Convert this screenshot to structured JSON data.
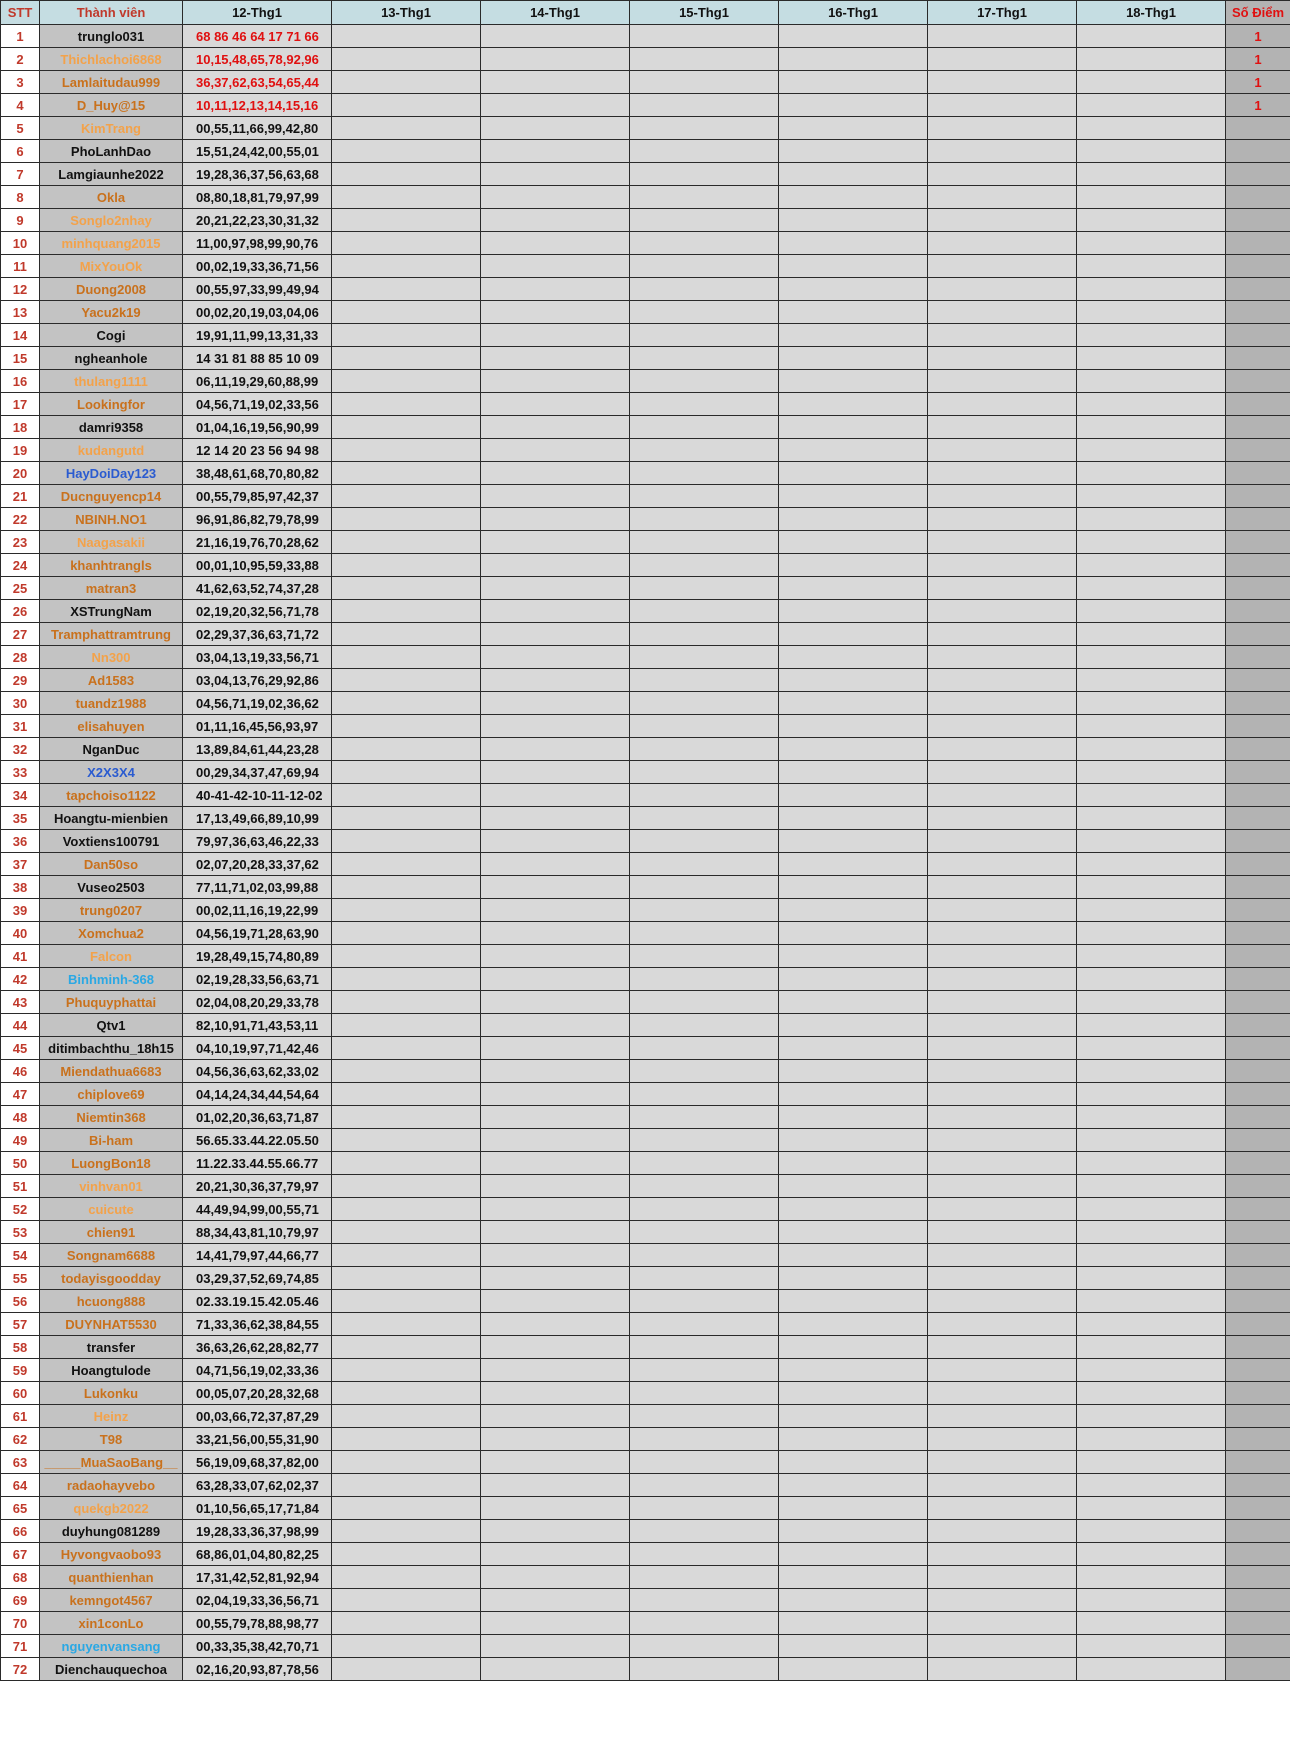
{
  "headers": {
    "stt": "STT",
    "member": "Thành viên",
    "days": [
      "12-Thg1",
      "13-Thg1",
      "14-Thg1",
      "15-Thg1",
      "16-Thg1",
      "17-Thg1",
      "18-Thg1"
    ],
    "points": "Số Điểm"
  },
  "colors": {
    "black": "#111111",
    "orange": "#c9711c",
    "light": "#f3a24a",
    "blue": "#2a5bd0",
    "cyan": "#2aa8e4",
    "red": "#e01010",
    "header_bg": "#c5dde2"
  },
  "rows": [
    {
      "stt": "1",
      "name": "trunglo031",
      "color": "black",
      "d12": "68 86 46 64 17 71 66",
      "red": true,
      "points": "1"
    },
    {
      "stt": "2",
      "name": "Thichlachoi6868",
      "color": "light",
      "d12": "10,15,48,65,78,92,96",
      "red": true,
      "points": "1"
    },
    {
      "stt": "3",
      "name": "Lamlaitudau999",
      "color": "orange",
      "d12": "36,37,62,63,54,65,44",
      "red": true,
      "points": "1"
    },
    {
      "stt": "4",
      "name": "D_Huy@15",
      "color": "orange",
      "d12": "10,11,12,13,14,15,16",
      "red": true,
      "points": "1"
    },
    {
      "stt": "5",
      "name": "KimTrang",
      "color": "light",
      "d12": "00,55,11,66,99,42,80",
      "red": false,
      "points": ""
    },
    {
      "stt": "6",
      "name": "PhoLanhDao",
      "color": "black",
      "d12": "15,51,24,42,00,55,01",
      "red": false,
      "points": ""
    },
    {
      "stt": "7",
      "name": "Lamgiaunhe2022",
      "color": "black",
      "d12": "19,28,36,37,56,63,68",
      "red": false,
      "points": ""
    },
    {
      "stt": "8",
      "name": "Okla",
      "color": "orange",
      "d12": "08,80,18,81,79,97,99",
      "red": false,
      "points": ""
    },
    {
      "stt": "9",
      "name": "Songlo2nhay",
      "color": "light",
      "d12": "20,21,22,23,30,31,32",
      "red": false,
      "points": ""
    },
    {
      "stt": "10",
      "name": "minhquang2015",
      "color": "light",
      "d12": "11,00,97,98,99,90,76",
      "red": false,
      "points": ""
    },
    {
      "stt": "11",
      "name": "MixYouOk",
      "color": "light",
      "d12": "00,02,19,33,36,71,56",
      "red": false,
      "points": ""
    },
    {
      "stt": "12",
      "name": "Duong2008",
      "color": "orange",
      "d12": "00,55,97,33,99,49,94",
      "red": false,
      "points": ""
    },
    {
      "stt": "13",
      "name": "Yacu2k19",
      "color": "orange",
      "d12": "00,02,20,19,03,04,06",
      "red": false,
      "points": ""
    },
    {
      "stt": "14",
      "name": "Cogi",
      "color": "black",
      "d12": "19,91,11,99,13,31,33",
      "red": false,
      "points": ""
    },
    {
      "stt": "15",
      "name": "ngheanhole",
      "color": "black",
      "d12": "14 31 81 88 85 10 09",
      "red": false,
      "points": ""
    },
    {
      "stt": "16",
      "name": "thulang1111",
      "color": "light",
      "d12": "06,11,19,29,60,88,99",
      "red": false,
      "points": ""
    },
    {
      "stt": "17",
      "name": "Lookingfor",
      "color": "orange",
      "d12": "04,56,71,19,02,33,56",
      "red": false,
      "points": ""
    },
    {
      "stt": "18",
      "name": "damri9358",
      "color": "black",
      "d12": "01,04,16,19,56,90,99",
      "red": false,
      "points": ""
    },
    {
      "stt": "19",
      "name": "kudangutd",
      "color": "light",
      "d12": "12 14 20 23 56 94 98",
      "red": false,
      "points": ""
    },
    {
      "stt": "20",
      "name": "HayDoiDay123",
      "color": "blue",
      "d12": "38,48,61,68,70,80,82",
      "red": false,
      "points": ""
    },
    {
      "stt": "21",
      "name": "Ducnguyencp14",
      "color": "orange",
      "d12": "00,55,79,85,97,42,37",
      "red": false,
      "points": ""
    },
    {
      "stt": "22",
      "name": "NBINH.NO1",
      "color": "orange",
      "d12": "96,91,86,82,79,78,99",
      "red": false,
      "points": ""
    },
    {
      "stt": "23",
      "name": "Naagasakii",
      "color": "light",
      "d12": "21,16,19,76,70,28,62",
      "red": false,
      "points": ""
    },
    {
      "stt": "24",
      "name": "khanhtrangls",
      "color": "orange",
      "d12": "00,01,10,95,59,33,88",
      "red": false,
      "points": ""
    },
    {
      "stt": "25",
      "name": "matran3",
      "color": "orange",
      "d12": "41,62,63,52,74,37,28",
      "red": false,
      "points": ""
    },
    {
      "stt": "26",
      "name": "XSTrungNam",
      "color": "black",
      "d12": "02,19,20,32,56,71,78",
      "red": false,
      "points": ""
    },
    {
      "stt": "27",
      "name": "Tramphattramtrung",
      "color": "orange",
      "d12": "02,29,37,36,63,71,72",
      "red": false,
      "points": ""
    },
    {
      "stt": "28",
      "name": "Nn300",
      "color": "light",
      "d12": "03,04,13,19,33,56,71",
      "red": false,
      "points": ""
    },
    {
      "stt": "29",
      "name": "Ad1583",
      "color": "orange",
      "d12": "03,04,13,76,29,92,86",
      "red": false,
      "points": ""
    },
    {
      "stt": "30",
      "name": "tuandz1988",
      "color": "orange",
      "d12": "04,56,71,19,02,36,62",
      "red": false,
      "points": ""
    },
    {
      "stt": "31",
      "name": "elisahuyen",
      "color": "orange",
      "d12": "01,11,16,45,56,93,97",
      "red": false,
      "points": ""
    },
    {
      "stt": "32",
      "name": "NganDuc",
      "color": "black",
      "d12": "13,89,84,61,44,23,28",
      "red": false,
      "points": ""
    },
    {
      "stt": "33",
      "name": "X2X3X4",
      "color": "blue",
      "d12": "00,29,34,37,47,69,94",
      "red": false,
      "points": ""
    },
    {
      "stt": "34",
      "name": "tapchoiso1122",
      "color": "orange",
      "d12": "40-41-42-10-11-12-02",
      "red": false,
      "points": ""
    },
    {
      "stt": "35",
      "name": "Hoangtu-mienbien",
      "color": "black",
      "d12": "17,13,49,66,89,10,99",
      "red": false,
      "points": ""
    },
    {
      "stt": "36",
      "name": "Voxtiens100791",
      "color": "black",
      "d12": "79,97,36,63,46,22,33",
      "red": false,
      "points": ""
    },
    {
      "stt": "37",
      "name": "Dan50so",
      "color": "orange",
      "d12": "02,07,20,28,33,37,62",
      "red": false,
      "points": ""
    },
    {
      "stt": "38",
      "name": "Vuseo2503",
      "color": "black",
      "d12": "77,11,71,02,03,99,88",
      "red": false,
      "points": ""
    },
    {
      "stt": "39",
      "name": "trung0207",
      "color": "orange",
      "d12": "00,02,11,16,19,22,99",
      "red": false,
      "points": ""
    },
    {
      "stt": "40",
      "name": "Xomchua2",
      "color": "orange",
      "d12": "04,56,19,71,28,63,90",
      "red": false,
      "points": ""
    },
    {
      "stt": "41",
      "name": "Falcon",
      "color": "light",
      "d12": "19,28,49,15,74,80,89",
      "red": false,
      "points": ""
    },
    {
      "stt": "42",
      "name": "Binhminh-368",
      "color": "cyan",
      "d12": "02,19,28,33,56,63,71",
      "red": false,
      "points": ""
    },
    {
      "stt": "43",
      "name": "Phuquyphattai",
      "color": "orange",
      "d12": "02,04,08,20,29,33,78",
      "red": false,
      "points": ""
    },
    {
      "stt": "44",
      "name": "Qtv1",
      "color": "black",
      "d12": "82,10,91,71,43,53,11",
      "red": false,
      "points": ""
    },
    {
      "stt": "45",
      "name": "ditimbachthu_18h15",
      "color": "black",
      "d12": "04,10,19,97,71,42,46",
      "red": false,
      "points": ""
    },
    {
      "stt": "46",
      "name": "Miendathua6683",
      "color": "orange",
      "d12": "04,56,36,63,62,33,02",
      "red": false,
      "points": ""
    },
    {
      "stt": "47",
      "name": "chiplove69",
      "color": "orange",
      "d12": "04,14,24,34,44,54,64",
      "red": false,
      "points": ""
    },
    {
      "stt": "48",
      "name": "Niemtin368",
      "color": "orange",
      "d12": "01,02,20,36,63,71,87",
      "red": false,
      "points": ""
    },
    {
      "stt": "49",
      "name": "Bi-ham",
      "color": "orange",
      "d12": "56.65.33.44.22.05.50",
      "red": false,
      "points": ""
    },
    {
      "stt": "50",
      "name": "LuongBon18",
      "color": "orange",
      "d12": "11.22.33.44.55.66.77",
      "red": false,
      "points": ""
    },
    {
      "stt": "51",
      "name": "vinhvan01",
      "color": "light",
      "d12": "20,21,30,36,37,79,97",
      "red": false,
      "points": ""
    },
    {
      "stt": "52",
      "name": "cuicute",
      "color": "light",
      "d12": "44,49,94,99,00,55,71",
      "red": false,
      "points": ""
    },
    {
      "stt": "53",
      "name": "chien91",
      "color": "orange",
      "d12": "88,34,43,81,10,79,97",
      "red": false,
      "points": ""
    },
    {
      "stt": "54",
      "name": "Songnam6688",
      "color": "orange",
      "d12": "14,41,79,97,44,66,77",
      "red": false,
      "points": ""
    },
    {
      "stt": "55",
      "name": "todayisgoodday",
      "color": "orange",
      "d12": "03,29,37,52,69,74,85",
      "red": false,
      "points": ""
    },
    {
      "stt": "56",
      "name": "hcuong888",
      "color": "orange",
      "d12": "02.33.19.15.42.05.46",
      "red": false,
      "points": ""
    },
    {
      "stt": "57",
      "name": "DUYNHAT5530",
      "color": "orange",
      "d12": "71,33,36,62,38,84,55",
      "red": false,
      "points": ""
    },
    {
      "stt": "58",
      "name": "transfer",
      "color": "black",
      "d12": "36,63,26,62,28,82,77",
      "red": false,
      "points": ""
    },
    {
      "stt": "59",
      "name": "Hoangtulode",
      "color": "black",
      "d12": "04,71,56,19,02,33,36",
      "red": false,
      "points": ""
    },
    {
      "stt": "60",
      "name": "Lukonku",
      "color": "orange",
      "d12": "00,05,07,20,28,32,68",
      "red": false,
      "points": ""
    },
    {
      "stt": "61",
      "name": "Heinz",
      "color": "light",
      "d12": "00,03,66,72,37,87,29",
      "red": false,
      "points": ""
    },
    {
      "stt": "62",
      "name": "T98",
      "color": "orange",
      "d12": "33,21,56,00,55,31,90",
      "red": false,
      "points": ""
    },
    {
      "stt": "63",
      "name": "_____MuaSaoBang__",
      "color": "orange",
      "d12": "56,19,09,68,37,82,00",
      "red": false,
      "points": ""
    },
    {
      "stt": "64",
      "name": "radaohayvebo",
      "color": "orange",
      "d12": "63,28,33,07,62,02,37",
      "red": false,
      "points": ""
    },
    {
      "stt": "65",
      "name": "quekgb2022",
      "color": "light",
      "d12": "01,10,56,65,17,71,84",
      "red": false,
      "points": ""
    },
    {
      "stt": "66",
      "name": "duyhung081289",
      "color": "black",
      "d12": "19,28,33,36,37,98,99",
      "red": false,
      "points": ""
    },
    {
      "stt": "67",
      "name": "Hyvongvaobo93",
      "color": "orange",
      "d12": "68,86,01,04,80,82,25",
      "red": false,
      "points": ""
    },
    {
      "stt": "68",
      "name": "quanthienhan",
      "color": "orange",
      "d12": "17,31,42,52,81,92,94",
      "red": false,
      "points": ""
    },
    {
      "stt": "69",
      "name": "kemngot4567",
      "color": "orange",
      "d12": "02,04,19,33,36,56,71",
      "red": false,
      "points": ""
    },
    {
      "stt": "70",
      "name": "xin1conLo",
      "color": "orange",
      "d12": "00,55,79,78,88,98,77",
      "red": false,
      "points": ""
    },
    {
      "stt": "71",
      "name": "nguyenvansang",
      "color": "cyan",
      "d12": "00,33,35,38,42,70,71",
      "red": false,
      "points": ""
    },
    {
      "stt": "72",
      "name": "Dienchauquechoa",
      "color": "black",
      "d12": "02,16,20,93,87,78,56",
      "red": false,
      "points": ""
    }
  ]
}
